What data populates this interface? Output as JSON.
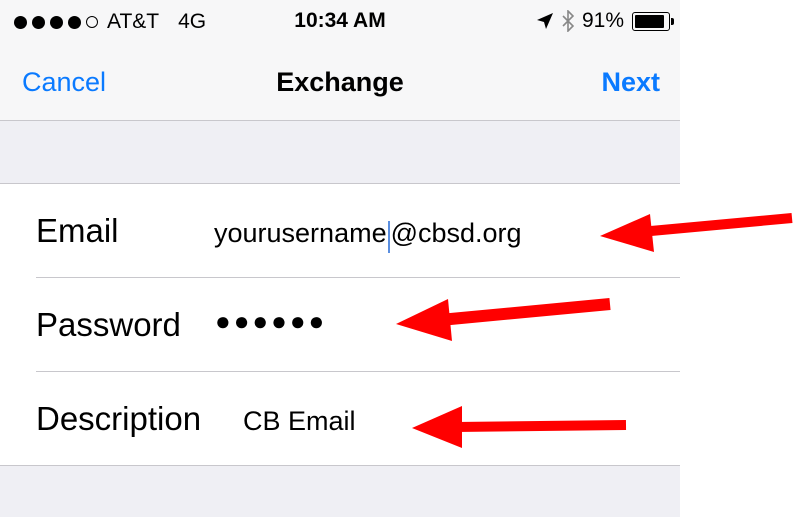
{
  "status_bar": {
    "carrier": "AT&T",
    "network": "4G",
    "time": "10:34 AM",
    "battery": "91%",
    "battery_level": 0.91
  },
  "nav": {
    "cancel_label": "Cancel",
    "title": "Exchange",
    "next_label": "Next"
  },
  "form": {
    "email_label": "Email",
    "email_value_before_cursor": "yourusername",
    "email_value_after_cursor": "@cbsd.org",
    "password_label": "Password",
    "password_value": "●●●●●●",
    "description_label": "Description",
    "description_value": "CB Email"
  },
  "colors": {
    "accent": "#0a7aff",
    "arrow": "#ff0000"
  },
  "icons": [
    "signal-dots-icon",
    "location-arrow-icon",
    "bluetooth-icon",
    "battery-icon"
  ]
}
